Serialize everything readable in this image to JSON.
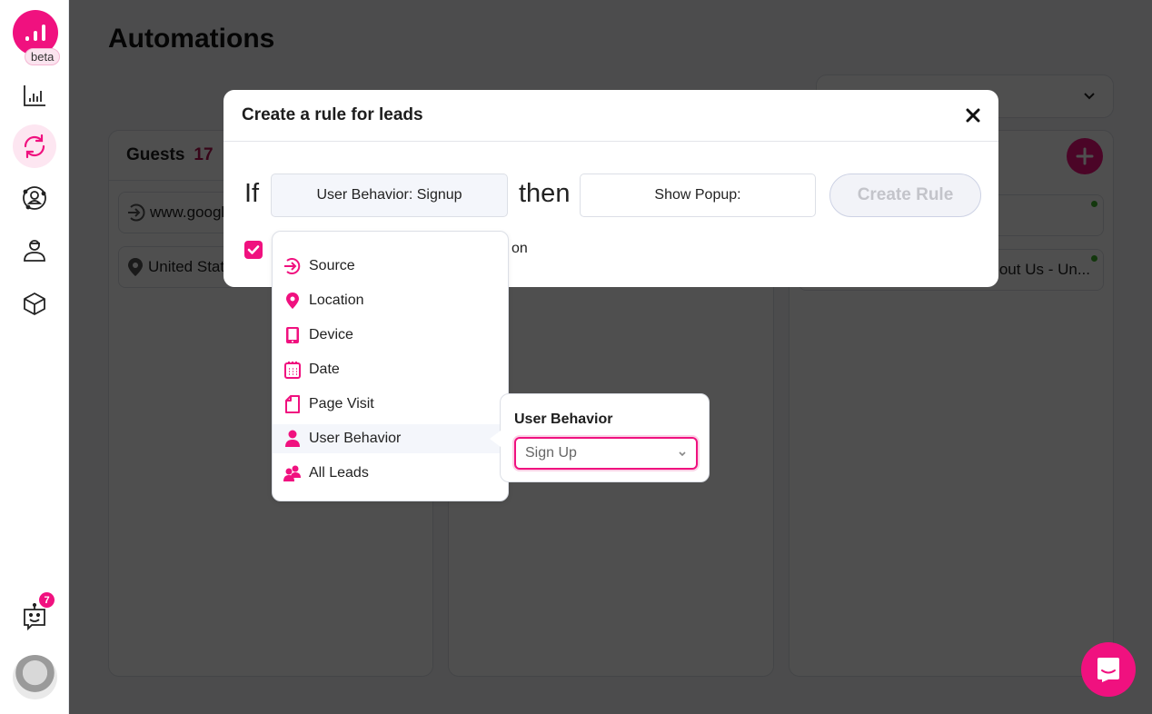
{
  "sidebar": {
    "beta_label": "beta",
    "notification_count": "7",
    "items": [
      {
        "name": "analytics"
      },
      {
        "name": "automations",
        "active": true
      },
      {
        "name": "leads"
      },
      {
        "name": "visitors"
      },
      {
        "name": "integrations"
      }
    ]
  },
  "page": {
    "title": "Automations"
  },
  "columns": [
    {
      "title": "Guests",
      "count": "17",
      "cards": [
        {
          "icon": "source-icon",
          "text": "www.google.com"
        },
        {
          "icon": "location-icon",
          "text": "United States"
        }
      ]
    },
    {
      "title": "",
      "count": "",
      "cards": []
    },
    {
      "title": "",
      "count": "",
      "cards": [
        {
          "text": ""
        },
        {
          "text": "About Us - Un..."
        }
      ]
    }
  ],
  "modal": {
    "title": "Create a rule for leads",
    "if_label": "If",
    "then_label": "then",
    "condition_value": "User Behavior: Signup",
    "action_value": "Show Popup:",
    "create_button": "Create Rule",
    "checkbox_checked": true,
    "checkbox_label_visible_end": "on"
  },
  "dropdown": {
    "items": [
      {
        "label": "Source",
        "icon": "source-icon"
      },
      {
        "label": "Location",
        "icon": "location-pin-icon"
      },
      {
        "label": "Device",
        "icon": "tablet-icon"
      },
      {
        "label": "Date",
        "icon": "calendar-icon"
      },
      {
        "label": "Page Visit",
        "icon": "page-icon"
      },
      {
        "label": "User Behavior",
        "icon": "user-icon",
        "selected": true
      },
      {
        "label": "All Leads",
        "icon": "users-icon"
      }
    ]
  },
  "subpopover": {
    "title": "User Behavior",
    "selected_value": "Sign Up"
  },
  "colors": {
    "accent": "#f0117f",
    "count": "#b3124f",
    "online": "#3db02a"
  }
}
